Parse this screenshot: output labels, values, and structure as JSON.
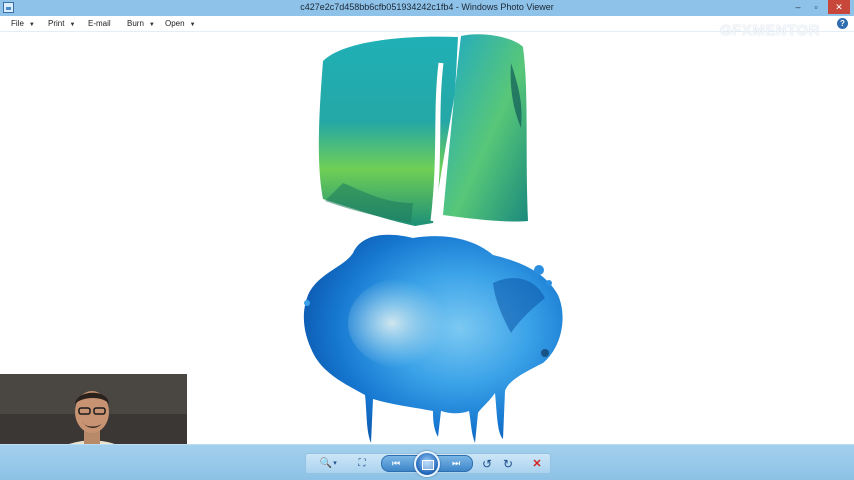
{
  "window": {
    "title": "c427e2c7d458bb6cfb051934242c1fb4 - Windows Photo Viewer",
    "controls": {
      "minimize": "–",
      "restore": "▫",
      "close": "✕"
    }
  },
  "menu": {
    "file": "File",
    "print": "Print",
    "email": "E-mail",
    "burn": "Burn",
    "open": "Open",
    "help": "?"
  },
  "watermark": "GFXMENTOR",
  "toolbar": {
    "zoom": "🔍",
    "zoom_arrow": "▾",
    "fit": "⛶",
    "previous": "⏮",
    "next": "⏭",
    "rotate_ccw": "↺",
    "rotate_cw": "↻",
    "delete": "✕"
  },
  "colors": {
    "titlebar": "#8fc2e8",
    "toolbar": "#9ccbea",
    "watercolor_green": "#2fb39a",
    "watercolor_blue": "#1e88d8",
    "delete_red": "#d42020"
  },
  "image_content": {
    "subject_top": "green-teal watercolor swatch",
    "subject_bottom": "blue watercolor splash with drips"
  }
}
